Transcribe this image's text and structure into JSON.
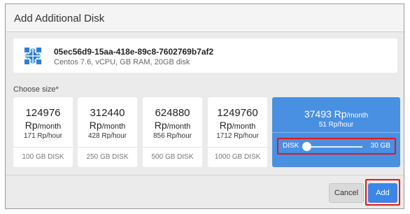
{
  "dialog": {
    "title": "Add Additional Disk"
  },
  "vm": {
    "name": "05ec56d9-15aa-418e-89c8-7602769b7af2",
    "description": "Centos 7.6, vCPU, GB RAM, 20GB disk",
    "icon": "centos-logo-icon"
  },
  "size_label": "Choose size*",
  "sizes": [
    {
      "price": "124976",
      "currency": "Rp",
      "per": "/month",
      "hourly": "171 Rp/hour",
      "disk": "100 GB DISK"
    },
    {
      "price": "312440",
      "currency": "Rp",
      "per": "/month",
      "hourly": "428 Rp/hour",
      "disk": "250 GB DISK"
    },
    {
      "price": "624880",
      "currency": "Rp",
      "per": "/month",
      "hourly": "856 Rp/hour",
      "disk": "500 GB DISK"
    },
    {
      "price": "1249760",
      "currency": "Rp",
      "per": "/month",
      "hourly": "1712 Rp/hour",
      "disk": "1000 GB DISK"
    }
  ],
  "custom": {
    "price": "37493 Rp",
    "per": "/month",
    "hourly": "51 Rp/hour",
    "slider_label": "DISK",
    "slider_value": "30 GB",
    "slider_level": 0.03
  },
  "buttons": {
    "cancel": "Cancel",
    "add": "Add"
  },
  "colors": {
    "accent": "#4a90e2",
    "primary_button": "#3b86e6",
    "highlight": "#e01818"
  }
}
